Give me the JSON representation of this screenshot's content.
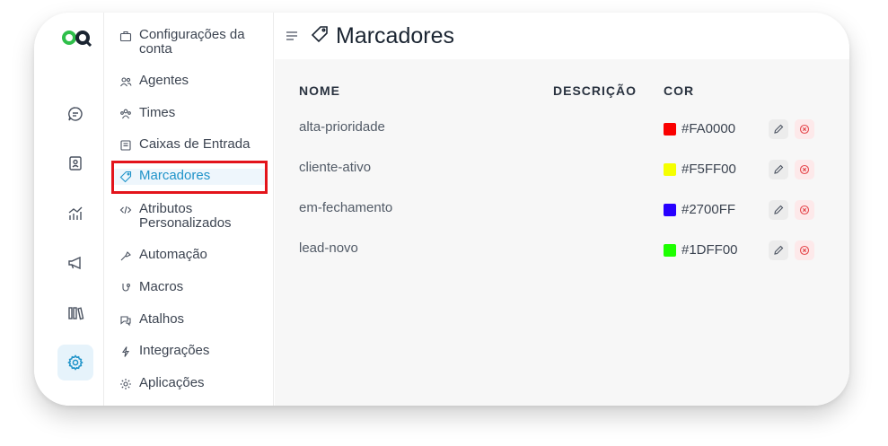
{
  "rail": {
    "items": [
      {
        "name": "conversations-icon"
      },
      {
        "name": "contacts-icon"
      },
      {
        "name": "reports-icon"
      },
      {
        "name": "campaigns-icon"
      },
      {
        "name": "library-icon"
      },
      {
        "name": "settings-icon",
        "active": true
      }
    ]
  },
  "menu": {
    "items": [
      {
        "label": "Configurações da conta",
        "icon": "briefcase-icon"
      },
      {
        "label": "Agentes",
        "icon": "people-icon"
      },
      {
        "label": "Times",
        "icon": "team-icon"
      },
      {
        "label": "Caixas de Entrada",
        "icon": "inbox-icon"
      },
      {
        "label": "Marcadores",
        "icon": "tag-icon",
        "active": true
      },
      {
        "label": "Atributos Personalizados",
        "icon": "code-icon"
      },
      {
        "label": "Automação",
        "icon": "automation-icon"
      },
      {
        "label": "Macros",
        "icon": "macro-icon"
      },
      {
        "label": "Atalhos",
        "icon": "chat-shortcut-icon"
      },
      {
        "label": "Integrações",
        "icon": "lightning-icon"
      },
      {
        "label": "Aplicações",
        "icon": "apps-icon"
      }
    ]
  },
  "header": {
    "title": "Marcadores"
  },
  "table": {
    "columns": {
      "name": "NOME",
      "description": "DESCRIÇÃO",
      "color": "COR"
    },
    "rows": [
      {
        "name": "alta-prioridade",
        "description": "",
        "color": "#FA0000"
      },
      {
        "name": "cliente-ativo",
        "description": "",
        "color": "#F5FF00"
      },
      {
        "name": "em-fechamento",
        "description": "",
        "color": "#2700FF"
      },
      {
        "name": "lead-novo",
        "description": "",
        "color": "#1DFF00"
      }
    ]
  },
  "colors": {
    "accent": "#1f93c9",
    "highlight_border": "#e3141b",
    "delete": "#e5484d"
  }
}
